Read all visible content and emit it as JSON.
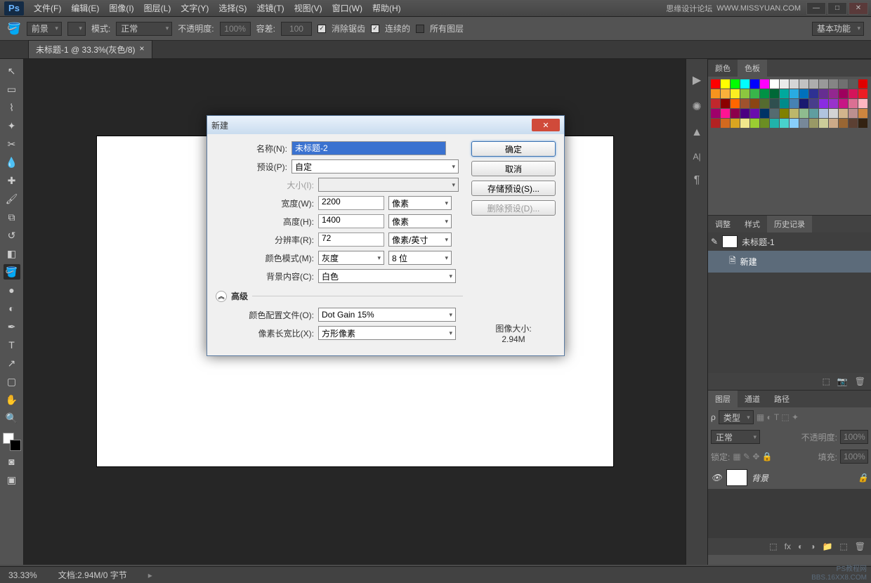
{
  "title": {
    "logo": "Ps",
    "right_text": "思缘设计论坛",
    "right_url": "WWW.MISSYUAN.COM"
  },
  "menu": [
    "文件(F)",
    "编辑(E)",
    "图像(I)",
    "图层(L)",
    "文字(Y)",
    "选择(S)",
    "滤镜(T)",
    "视图(V)",
    "窗口(W)",
    "帮助(H)"
  ],
  "options": {
    "fill_label": "前景",
    "mode_label": "模式:",
    "mode_value": "正常",
    "opacity_label": "不透明度:",
    "opacity_value": "100%",
    "tolerance_label": "容差:",
    "tolerance_value": "100",
    "antialias": "消除锯齿",
    "contiguous": "连续的",
    "all_layers": "所有图层",
    "workspace": "基本功能"
  },
  "doc_tab": "未标题-1 @ 33.3%(灰色/8)",
  "panels": {
    "color_tabs": [
      "颜色",
      "色板"
    ],
    "adjust_tabs": [
      "调整",
      "样式",
      "历史记录"
    ],
    "history_doc": "未标题-1",
    "history_item": "新建",
    "layer_tabs": [
      "图层",
      "通道",
      "路径"
    ],
    "layer_kind": "类型",
    "layer_blend": "正常",
    "layer_opacity_label": "不透明度:",
    "layer_opacity_value": "100%",
    "layer_lock_label": "锁定:",
    "layer_fill_label": "填充:",
    "layer_fill_value": "100%",
    "layer_name": "背景"
  },
  "dialog": {
    "title": "新建",
    "name_label": "名称(N):",
    "name_value": "未标题-2",
    "preset_label": "预设(P):",
    "preset_value": "自定",
    "size_label": "大小(I):",
    "width_label": "宽度(W):",
    "width_value": "2200",
    "width_unit": "像素",
    "height_label": "高度(H):",
    "height_value": "1400",
    "height_unit": "像素",
    "res_label": "分辨率(R):",
    "res_value": "72",
    "res_unit": "像素/英寸",
    "mode_label": "颜色模式(M):",
    "mode_value": "灰度",
    "depth_value": "8 位",
    "bg_label": "背景内容(C):",
    "bg_value": "白色",
    "advanced": "高级",
    "profile_label": "颜色配置文件(O):",
    "profile_value": "Dot Gain 15%",
    "aspect_label": "像素长宽比(X):",
    "aspect_value": "方形像素",
    "ok": "确定",
    "cancel": "取消",
    "save_preset": "存储预设(S)...",
    "delete_preset": "删除预设(D)...",
    "image_size_label": "图像大小:",
    "image_size_value": "2.94M"
  },
  "status": {
    "zoom": "33.33%",
    "doc": "文档:2.94M/0 字节"
  },
  "watermark": {
    "line1": "PS教程网",
    "line2": "BBS.16XX8.COM"
  },
  "swatch_colors": [
    "#ff0000",
    "#ffff00",
    "#00ff00",
    "#00ffff",
    "#0000ff",
    "#ff00ff",
    "#ffffff",
    "#ebebeb",
    "#d6d6d6",
    "#c2c2c2",
    "#adadad",
    "#999999",
    "#858585",
    "#707070",
    "#5c5c5c",
    "#e00000",
    "#f7931e",
    "#fbb03b",
    "#fcee21",
    "#8cc63f",
    "#39b54a",
    "#009245",
    "#006837",
    "#00a99d",
    "#29abe2",
    "#0071bc",
    "#2e3192",
    "#662d91",
    "#93278f",
    "#9e005d",
    "#d4145a",
    "#ed1c24",
    "#c1272d",
    "#8b0000",
    "#ff6600",
    "#a0522d",
    "#8b4513",
    "#556b2f",
    "#2f4f4f",
    "#008b8b",
    "#4682b4",
    "#191970",
    "#483d8b",
    "#8a2be2",
    "#9932cc",
    "#c71585",
    "#db7093",
    "#ffb6c1",
    "#a0006a",
    "#ff1493",
    "#8c004b",
    "#4b0082",
    "#6a0dad",
    "#003366",
    "#556b70",
    "#808000",
    "#bdb76b",
    "#8fbc8f",
    "#5f9ea0",
    "#b0c4de",
    "#d3d3d3",
    "#d2b48c",
    "#bc8f8f",
    "#cd853f",
    "#b22222",
    "#d2691e",
    "#daa520",
    "#f0e68c",
    "#9acd32",
    "#6b8e23",
    "#20b2aa",
    "#48d1cc",
    "#87cefa",
    "#778899",
    "#999966",
    "#cccc99",
    "#ccaa88",
    "#996633",
    "#5c4033",
    "#332211"
  ]
}
